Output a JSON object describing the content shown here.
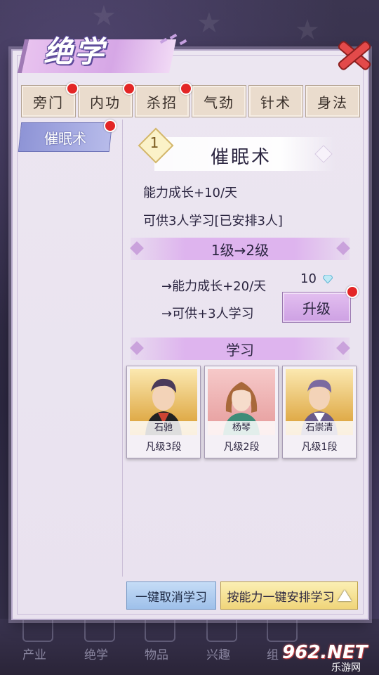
{
  "title": "绝学",
  "tabs": [
    {
      "label": "旁门",
      "badge": true
    },
    {
      "label": "内功",
      "badge": true
    },
    {
      "label": "杀招",
      "badge": true
    },
    {
      "label": "气劲",
      "badge": false
    },
    {
      "label": "针术",
      "badge": false
    },
    {
      "label": "身法",
      "badge": false
    }
  ],
  "sidebar": {
    "items": [
      {
        "label": "催眠术",
        "badge": true
      }
    ]
  },
  "skill": {
    "level": "1",
    "name": "催眠术",
    "growth": "能力成长+10/天",
    "capacity": "可供3人学习[已安排3人]"
  },
  "upgrade": {
    "header": "1级→2级",
    "growth": "→能力成长+20/天",
    "capacity": "→可供+3人学习",
    "cost": "10",
    "cost_icon": "diamond-icon",
    "button": "升级"
  },
  "study": {
    "header": "学习",
    "students": [
      {
        "name": "石驰",
        "rank": "凡级3段"
      },
      {
        "name": "杨琴",
        "rank": "凡级2段"
      },
      {
        "name": "石崇清",
        "rank": "凡级1段"
      }
    ]
  },
  "actions": {
    "cancel": "一键取消学习",
    "arrange": "按能力一键安排学习"
  },
  "bottom_nav": [
    "产业",
    "绝学",
    "物品",
    "兴趣",
    "组"
  ],
  "watermark": {
    "logo": "962.NET",
    "sub": "乐游网"
  },
  "colors": {
    "accent_purple": "#deb4ee",
    "badge_red": "#e32626",
    "tab_bg": "#eadccd"
  }
}
